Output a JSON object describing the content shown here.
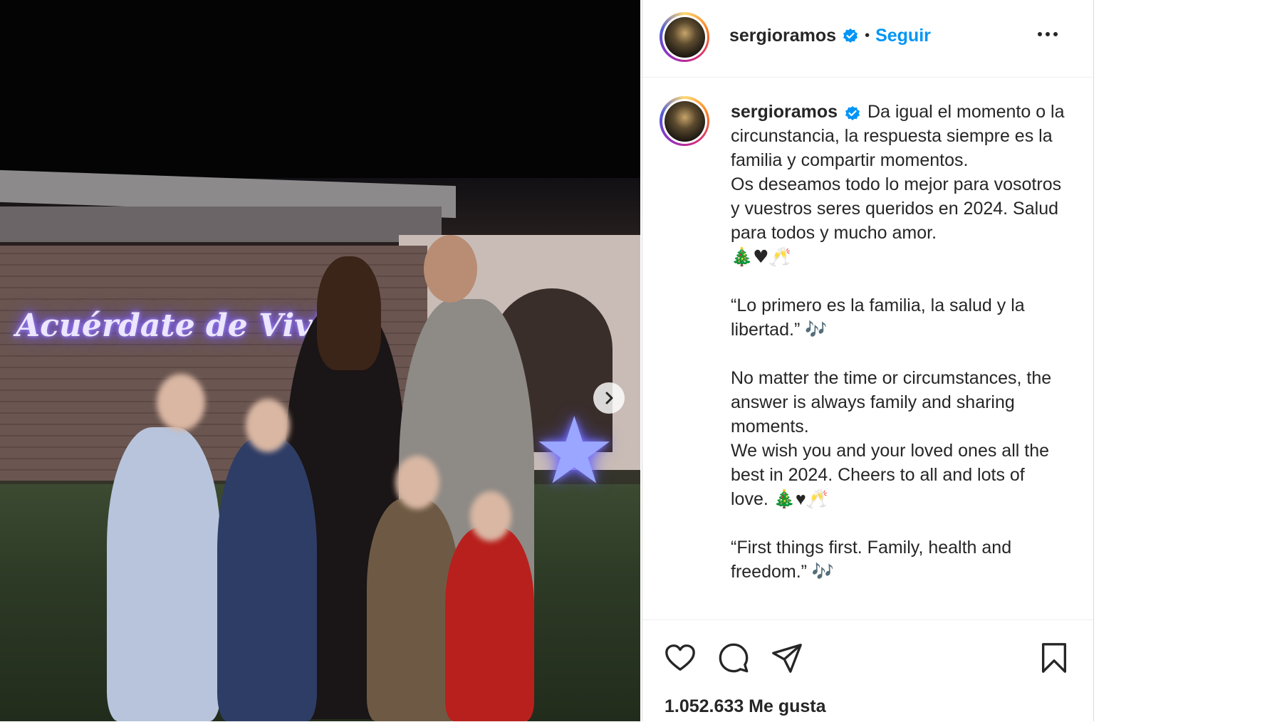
{
  "post": {
    "author": {
      "username": "sergioramos",
      "verified_icon": "verified-badge-icon",
      "follow_label": "Seguir",
      "separator": "•"
    },
    "photo": {
      "neon_sign_text": "Acuérdate de Vivir...",
      "next_icon": "chevron-right-icon"
    },
    "caption": {
      "username": "sergioramos",
      "lines": [
        "Da igual el momento o la circunstancia, la respuesta siempre es la familia y compartir momentos.",
        "Os deseamos todo lo mejor para vosotros y vuestros seres queridos en 2024. Salud para todos y mucho amor.",
        "🎄♥🥂",
        "“Lo primero es la familia, la salud y la libertad.” 🎶",
        "No matter the time or circumstances, the answer is always family and sharing moments.",
        "We wish you and your loved ones all the best in 2024. Cheers to all and lots of love. 🎄♥🥂",
        "“First things first. Family, health and freedom.” 🎶"
      ]
    },
    "actions": {
      "like_icon": "heart-icon",
      "comment_icon": "comment-icon",
      "share_icon": "send-icon",
      "save_icon": "bookmark-icon",
      "more_icon": "more-options-icon"
    },
    "likes_text": "1.052.633 Me gusta"
  },
  "colors": {
    "follow": "#0095f6",
    "text": "#262626",
    "verified": "#0095f6",
    "border": "#dbdbdb"
  }
}
